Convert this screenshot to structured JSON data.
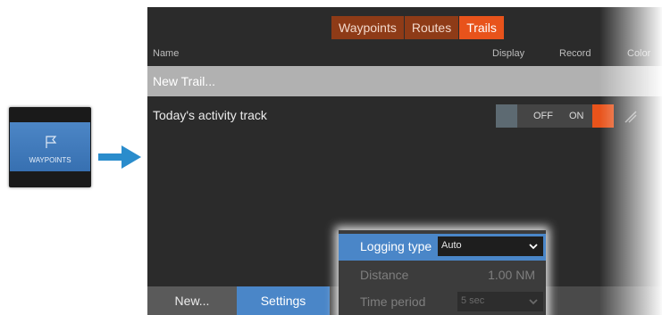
{
  "shortcut": {
    "label": "WAYPOINTS",
    "icon": "flag-icon"
  },
  "arrow": {
    "icon": "arrow-right-icon",
    "color": "#2a8ccc"
  },
  "tabs": [
    {
      "label": "Waypoints",
      "active": false
    },
    {
      "label": "Routes",
      "active": false
    },
    {
      "label": "Trails",
      "active": true
    }
  ],
  "columns": {
    "name": "Name",
    "display": "Display",
    "record": "Record",
    "color": "Color"
  },
  "rows": {
    "new_trail": "New Trail...",
    "track": {
      "name": "Today's activity track",
      "display": "OFF",
      "record": "ON"
    }
  },
  "bottom": {
    "new_label": "New...",
    "settings_label": "Settings"
  },
  "popup": {
    "logging_type": {
      "label": "Logging type",
      "value": "Auto"
    },
    "distance": {
      "label": "Distance",
      "value": "1.00 NM"
    },
    "time_period": {
      "label": "Time period",
      "value": "5 sec"
    }
  },
  "colors": {
    "accent": "#e8531b",
    "selection": "#4a86c8",
    "panel": "#2b2b2b"
  }
}
